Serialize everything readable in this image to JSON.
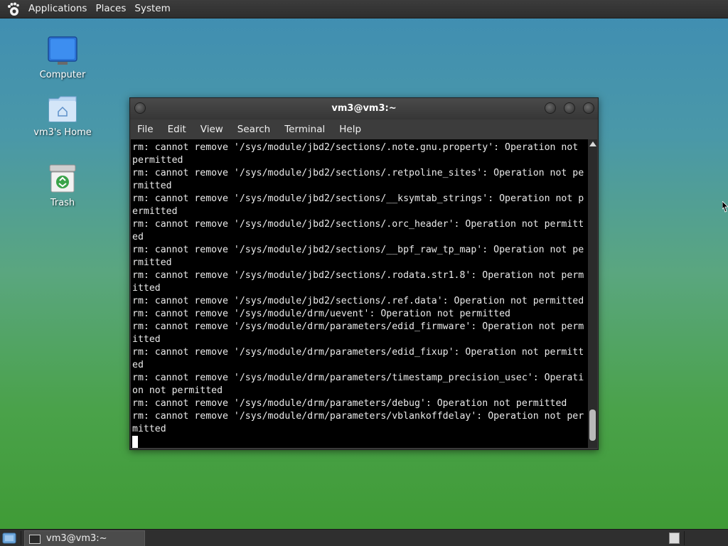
{
  "top_panel": {
    "menus": [
      "Applications",
      "Places",
      "System"
    ]
  },
  "desktop": {
    "icons": [
      {
        "label": "Computer"
      },
      {
        "label": "vm3's Home"
      },
      {
        "label": "Trash"
      }
    ]
  },
  "window": {
    "title": "vm3@vm3:~",
    "menu": [
      "File",
      "Edit",
      "View",
      "Search",
      "Terminal",
      "Help"
    ],
    "lines": [
      "rm: cannot remove '/sys/module/jbd2/sections/.note.gnu.property': Operation not",
      "permitted",
      "rm: cannot remove '/sys/module/jbd2/sections/.retpoline_sites': Operation not pe",
      "rmitted",
      "rm: cannot remove '/sys/module/jbd2/sections/__ksymtab_strings': Operation not p",
      "ermitted",
      "rm: cannot remove '/sys/module/jbd2/sections/.orc_header': Operation not permitt",
      "ed",
      "rm: cannot remove '/sys/module/jbd2/sections/__bpf_raw_tp_map': Operation not pe",
      "rmitted",
      "rm: cannot remove '/sys/module/jbd2/sections/.rodata.str1.8': Operation not perm",
      "itted",
      "rm: cannot remove '/sys/module/jbd2/sections/.ref.data': Operation not permitted",
      "rm: cannot remove '/sys/module/drm/uevent': Operation not permitted",
      "rm: cannot remove '/sys/module/drm/parameters/edid_firmware': Operation not perm",
      "itted",
      "rm: cannot remove '/sys/module/drm/parameters/edid_fixup': Operation not permitt",
      "ed",
      "rm: cannot remove '/sys/module/drm/parameters/timestamp_precision_usec': Operati",
      "on not permitted",
      "rm: cannot remove '/sys/module/drm/parameters/debug': Operation not permitted",
      "rm: cannot remove '/sys/module/drm/parameters/vblankoffdelay': Operation not per",
      "mitted"
    ]
  },
  "taskbar": {
    "task_label": "vm3@vm3:~"
  },
  "colors": {
    "terminal_bg": "#000000",
    "terminal_fg": "#eaeaea",
    "panel_bg": "#2f2f2f"
  }
}
